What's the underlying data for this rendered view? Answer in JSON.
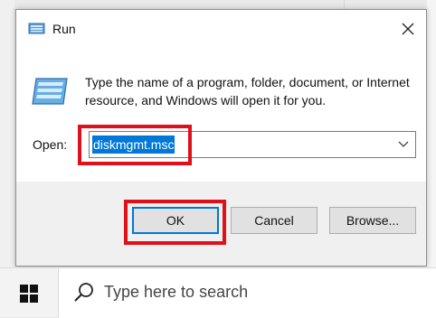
{
  "dialog": {
    "title": "Run",
    "description": "Type the name of a program, folder, document, or Internet resource, and Windows will open it for you.",
    "open_label": "Open:",
    "open_value": "diskmgmt.msc",
    "buttons": {
      "ok": "OK",
      "cancel": "Cancel",
      "browse": "Browse..."
    }
  },
  "taskbar": {
    "search_placeholder": "Type here to search"
  },
  "icons": {
    "title": "run-icon",
    "close": "close-icon",
    "dropdown": "chevron-down-icon",
    "start": "windows-start-icon",
    "search": "search-icon"
  },
  "colors": {
    "highlight": "#e0101a",
    "selection": "#0078d7",
    "accent": "#0078d7"
  }
}
